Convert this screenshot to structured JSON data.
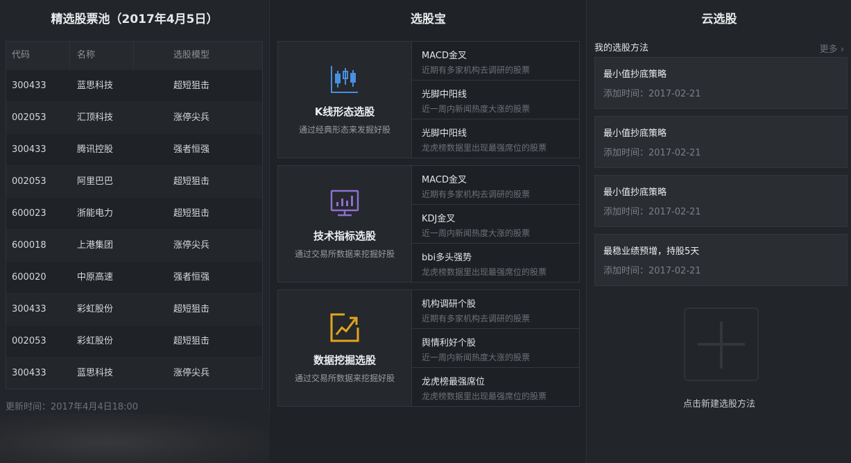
{
  "left": {
    "title": "精选股票池（2017年4月5日）",
    "headers": [
      "代码",
      "名称",
      "选股模型"
    ],
    "rows": [
      {
        "code": "300433",
        "name": "蓝思科技",
        "model": "超短狙击"
      },
      {
        "code": "002053",
        "name": "汇顶科技",
        "model": "涨停尖兵"
      },
      {
        "code": "300433",
        "name": "腾讯控股",
        "model": "强者恒强"
      },
      {
        "code": "002053",
        "name": "阿里巴巴",
        "model": "超短狙击"
      },
      {
        "code": "600023",
        "name": "浙能电力",
        "model": "超短狙击"
      },
      {
        "code": "600018",
        "name": "上港集团",
        "model": "涨停尖兵"
      },
      {
        "code": "600020",
        "name": "中原高速",
        "model": "强者恒强"
      },
      {
        "code": "300433",
        "name": "彩虹股份",
        "model": "超短狙击"
      },
      {
        "code": "002053",
        "name": "彩虹股份",
        "model": "超短狙击"
      },
      {
        "code": "300433",
        "name": "蓝思科技",
        "model": "涨停尖兵"
      }
    ],
    "update_time": "更新时间：2017年4月4日18:00"
  },
  "middle": {
    "title": "选股宝",
    "cards": [
      {
        "icon": "candlestick-icon",
        "icon_color": "#4a8fe0",
        "name": "K线形态选股",
        "desc": "通过经典形态来发掘好股",
        "items": [
          {
            "title": "MACD金叉",
            "desc": "近期有多家机构去调研的股票"
          },
          {
            "title": "光脚中阳线",
            "desc": "近一周内新闻热度大涨的股票"
          },
          {
            "title": "光脚中阳线",
            "desc": "龙虎榜数据里出现最强席位的股票"
          }
        ]
      },
      {
        "icon": "monitor-chart-icon",
        "icon_color": "#8e6fd1",
        "name": "技术指标选股",
        "desc": "通过交易所数据来挖掘好股",
        "items": [
          {
            "title": "MACD金叉",
            "desc": "近期有多家机构去调研的股票"
          },
          {
            "title": "KDJ金叉",
            "desc": "近一周内新闻热度大涨的股票"
          },
          {
            "title": "bbi多头强势",
            "desc": "龙虎榜数据里出现最强席位的股票"
          }
        ]
      },
      {
        "icon": "trend-chart-icon",
        "icon_color": "#e5a51c",
        "name": "数据挖掘选股",
        "desc": "通过交易所数据来挖掘好股",
        "items": [
          {
            "title": "机构调研个股",
            "desc": "近期有多家机构去调研的股票"
          },
          {
            "title": "舆情利好个股",
            "desc": "近一周内新闻热度大涨的股票"
          },
          {
            "title": "龙虎榜最强席位",
            "desc": "龙虎榜数据里出现最强席位的股票"
          }
        ]
      }
    ]
  },
  "right": {
    "title": "云选股",
    "my_methods": "我的选股方法",
    "more": "更多 ›",
    "strategies": [
      {
        "name": "最小值抄底策略",
        "time": "添加时间：2017-02-21"
      },
      {
        "name": "最小值抄底策略",
        "time": "添加时间：2017-02-21"
      },
      {
        "name": "最小值抄底策略",
        "time": "添加时间：2017-02-21"
      },
      {
        "name": "最稳业绩预增，持股5天",
        "time": "添加时间：2017-02-21"
      }
    ],
    "add_label": "点击新建选股方法"
  }
}
